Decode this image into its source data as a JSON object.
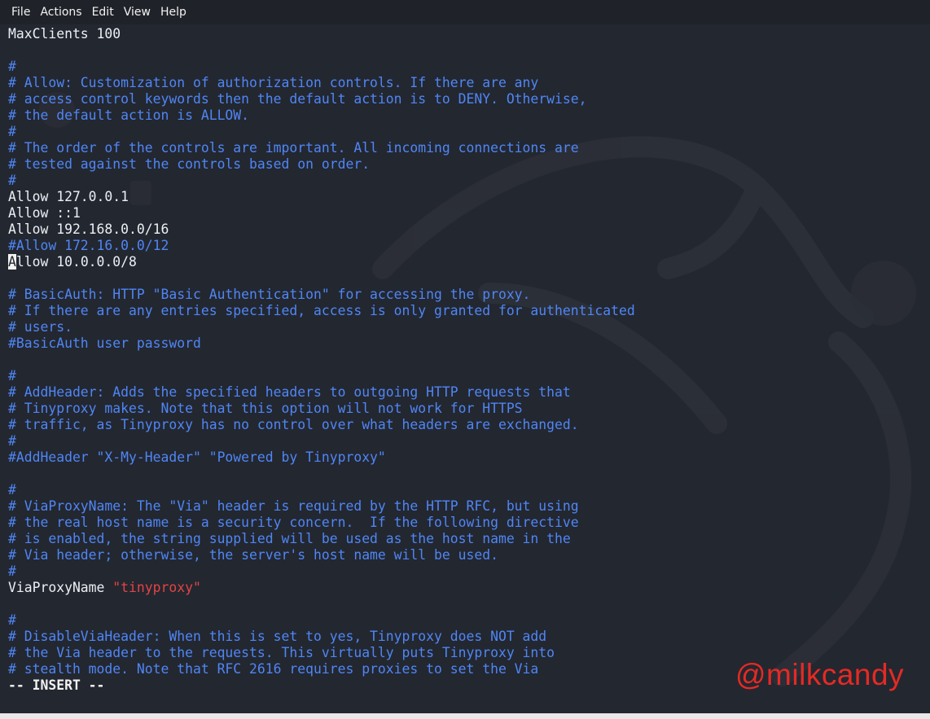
{
  "menubar": {
    "items": [
      "File",
      "Actions",
      "Edit",
      "View",
      "Help"
    ]
  },
  "editor": {
    "lines": [
      {
        "kind": "text",
        "text": "MaxClients 100"
      },
      {
        "kind": "text",
        "text": ""
      },
      {
        "kind": "comment",
        "text": "#"
      },
      {
        "kind": "comment",
        "text": "# Allow: Customization of authorization controls. If there are any"
      },
      {
        "kind": "comment",
        "text": "# access control keywords then the default action is to DENY. Otherwise,"
      },
      {
        "kind": "comment",
        "text": "# the default action is ALLOW."
      },
      {
        "kind": "comment",
        "text": "#"
      },
      {
        "kind": "comment",
        "text": "# The order of the controls are important. All incoming connections are"
      },
      {
        "kind": "comment",
        "text": "# tested against the controls based on order."
      },
      {
        "kind": "comment",
        "text": "#"
      },
      {
        "kind": "text",
        "text": "Allow 127.0.0.1"
      },
      {
        "kind": "text",
        "text": "Allow ::1"
      },
      {
        "kind": "text",
        "text": "Allow 192.168.0.0/16"
      },
      {
        "kind": "comment",
        "text": "#Allow 172.16.0.0/12"
      },
      {
        "kind": "cursor",
        "cursor_char": "A",
        "text": "llow 10.0.0.0/8"
      },
      {
        "kind": "text",
        "text": ""
      },
      {
        "kind": "comment",
        "text": "# BasicAuth: HTTP \"Basic Authentication\" for accessing the proxy."
      },
      {
        "kind": "comment",
        "text": "# If there are any entries specified, access is only granted for authenticated"
      },
      {
        "kind": "comment",
        "text": "# users."
      },
      {
        "kind": "comment",
        "text": "#BasicAuth user password"
      },
      {
        "kind": "text",
        "text": ""
      },
      {
        "kind": "comment",
        "text": "#"
      },
      {
        "kind": "comment",
        "text": "# AddHeader: Adds the specified headers to outgoing HTTP requests that"
      },
      {
        "kind": "comment",
        "text": "# Tinyproxy makes. Note that this option will not work for HTTPS"
      },
      {
        "kind": "comment",
        "text": "# traffic, as Tinyproxy has no control over what headers are exchanged."
      },
      {
        "kind": "comment",
        "text": "#"
      },
      {
        "kind": "comment",
        "text": "#AddHeader \"X-My-Header\" \"Powered by Tinyproxy\""
      },
      {
        "kind": "text",
        "text": ""
      },
      {
        "kind": "comment",
        "text": "#"
      },
      {
        "kind": "comment",
        "text": "# ViaProxyName: The \"Via\" header is required by the HTTP RFC, but using"
      },
      {
        "kind": "comment",
        "text": "# the real host name is a security concern.  If the following directive"
      },
      {
        "kind": "comment",
        "text": "# is enabled, the string supplied will be used as the host name in the"
      },
      {
        "kind": "comment",
        "text": "# Via header; otherwise, the server's host name will be used."
      },
      {
        "kind": "comment",
        "text": "#"
      },
      {
        "kind": "keystring",
        "text": "ViaProxyName ",
        "string": "\"tinyproxy\""
      },
      {
        "kind": "text",
        "text": ""
      },
      {
        "kind": "comment",
        "text": "#"
      },
      {
        "kind": "comment",
        "text": "# DisableViaHeader: When this is set to yes, Tinyproxy does NOT add"
      },
      {
        "kind": "comment",
        "text": "# the Via header to the requests. This virtually puts Tinyproxy into"
      },
      {
        "kind": "comment",
        "text": "# stealth mode. Note that RFC 2616 requires proxies to set the Via"
      },
      {
        "kind": "mode",
        "text": "-- INSERT --"
      }
    ]
  },
  "watermark": "@milkcandy",
  "colors": {
    "background": "#232730",
    "text": "#eceff4",
    "comment": "#4f86f5",
    "string": "#e24444",
    "watermark": "#e52a24"
  }
}
